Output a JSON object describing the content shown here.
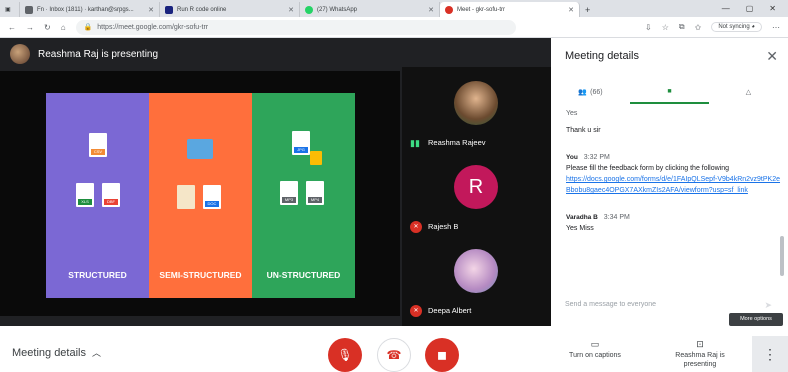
{
  "browser": {
    "tabs": [
      {
        "label": "Fn · Inbox (1811) · karthan@srpgs...",
        "icon": "mail-icon",
        "color": "#5f6368"
      },
      {
        "label": "Run R code online",
        "icon": "r-icon",
        "color": "#1a237e"
      },
      {
        "label": "(27) WhatsApp",
        "icon": "whatsapp-icon",
        "color": "#25d366"
      },
      {
        "label": "Meet - gkr-sofu-trr",
        "icon": "meet-icon",
        "color": "#d93025"
      }
    ],
    "new_tab": "+",
    "url": "https://meet.google.com/gkr-sofu-trr",
    "sync_label": "Not syncing"
  },
  "meet": {
    "presenter_banner": "Reashma Raj is presenting",
    "slide": {
      "columns": [
        {
          "label": "STRUCTURED",
          "color": "#7b68d4",
          "docs": [
            "CSV",
            "XLS",
            "DBF"
          ]
        },
        {
          "label": "SEMI-STRUCTURED",
          "color": "#ff6f3c",
          "docs": [
            "",
            "",
            "DOC"
          ]
        },
        {
          "label": "UN-STRUCTURED",
          "color": "#2ea55a",
          "docs": [
            "JPG",
            "",
            "MP3",
            "MP4"
          ]
        }
      ]
    },
    "participants": [
      {
        "name": "Reashma Rajeev",
        "state": "speaking"
      },
      {
        "name": "Rajesh B",
        "state": "muted",
        "initial": "R"
      },
      {
        "name": "Deepa Albert",
        "state": "muted"
      }
    ]
  },
  "panel": {
    "title": "Meeting details",
    "people_count": "(66)",
    "messages": [
      {
        "sender": "",
        "time": "",
        "text": "Yes"
      },
      {
        "sender": "",
        "time": "",
        "text": "Thank u sir"
      },
      {
        "sender": "You",
        "time": "3:32 PM",
        "text": "Please fill the feedback form by clicking the following",
        "link": "https://docs.google.com/forms/d/e/1FAIpQLSepf-V9b4kRn2vz9tPK2eBbobu8gaec4OPGX7AXkmZIs2AFA/viewform?usp=sf_link"
      },
      {
        "sender": "Varadha B",
        "time": "3:34 PM",
        "text": "Yes Miss"
      }
    ],
    "input_placeholder": "Send a message to everyone"
  },
  "bottom": {
    "meeting_details": "Meeting details",
    "captions": "Turn on captions",
    "presenting": "Reashma Raj is presenting",
    "more_tooltip": "More options"
  }
}
